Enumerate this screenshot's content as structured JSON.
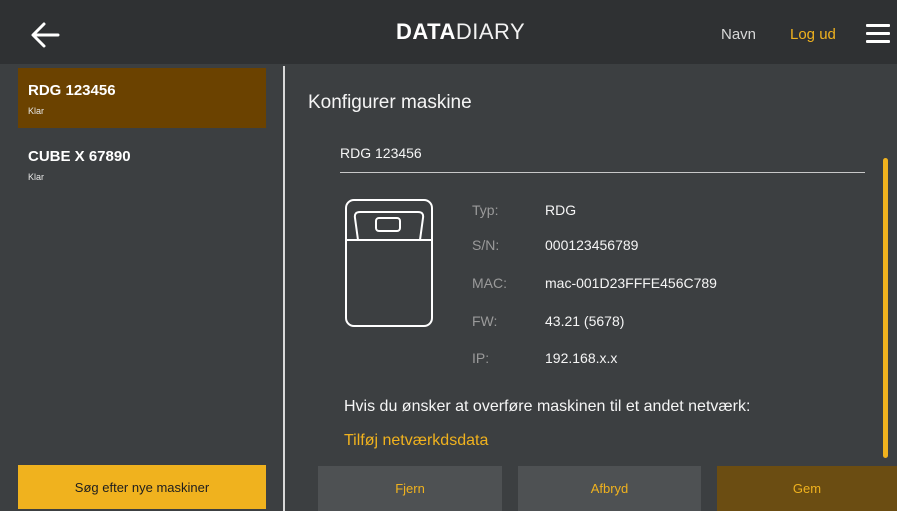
{
  "header": {
    "logo_bold": "DATA",
    "logo_thin": "DIARY",
    "nav_name": "Navn",
    "nav_logout": "Log ud",
    "accent_color": "#f0b21e"
  },
  "sidebar": {
    "machines": [
      {
        "name": "RDG 123456",
        "status": "Klar",
        "active": true
      },
      {
        "name": "CUBE X 67890",
        "status": "Klar",
        "active": false
      }
    ],
    "search_button": "Søg efter nye maskiner"
  },
  "main": {
    "title": "Konfigurer maskine",
    "machine_name": "RDG 123456",
    "specs": [
      {
        "label": "Typ:",
        "value": "RDG"
      },
      {
        "label": "S/N:",
        "value": "000123456789"
      },
      {
        "label": "MAC:",
        "value": "mac-001D23FFFE456C789"
      },
      {
        "label": "FW:",
        "value": "43.21 (5678)"
      },
      {
        "label": "IP:",
        "value": "192.168.x.x"
      }
    ],
    "transfer_text": "Hvis du ønsker at overføre maskinen til et andet netværk:",
    "add_network_link": "Tilføj netværkdsdata",
    "buttons": {
      "remove": "Fjern",
      "cancel": "Afbryd",
      "save": "Gem"
    }
  },
  "icons": {
    "back": "arrow-left-icon",
    "menu": "hamburger-menu-icon",
    "device": "machine-device-icon"
  }
}
